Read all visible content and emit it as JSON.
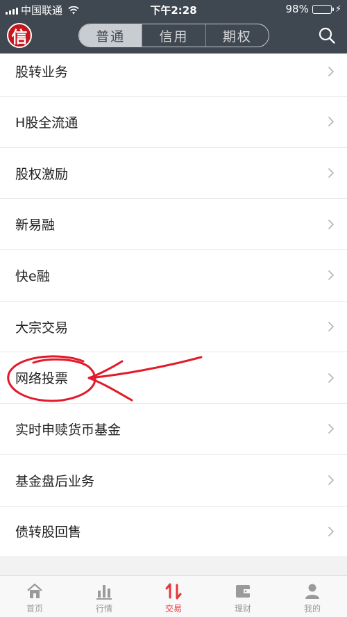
{
  "status_bar": {
    "carrier": "中国联通",
    "time": "下午2:28",
    "battery": "98%",
    "battery_level": 0.98
  },
  "header": {
    "logo_text": "信",
    "tabs": [
      {
        "label": "普通",
        "active": true
      },
      {
        "label": "信用",
        "active": false
      },
      {
        "label": "期权",
        "active": false
      }
    ],
    "search_icon": "search-icon"
  },
  "menu": {
    "items": [
      {
        "label": "股转业务"
      },
      {
        "label": "H股全流通"
      },
      {
        "label": "股权激励"
      },
      {
        "label": "新易融"
      },
      {
        "label": "快e融"
      },
      {
        "label": "大宗交易"
      },
      {
        "label": "网络投票"
      },
      {
        "label": "实时申赎货币基金"
      },
      {
        "label": "基金盘后业务"
      },
      {
        "label": "债转股回售"
      }
    ]
  },
  "tabbar": {
    "items": [
      {
        "label": "首页",
        "icon": "home-icon",
        "active": false
      },
      {
        "label": "行情",
        "icon": "chart-icon",
        "active": false
      },
      {
        "label": "交易",
        "icon": "trade-icon",
        "active": true
      },
      {
        "label": "理财",
        "icon": "wallet-icon",
        "active": false
      },
      {
        "label": "我的",
        "icon": "profile-icon",
        "active": false
      }
    ]
  },
  "colors": {
    "header_bg": "#3f4750",
    "accent": "#e8333b",
    "logo": "#c8161d",
    "annotation": "#e31a2a"
  }
}
